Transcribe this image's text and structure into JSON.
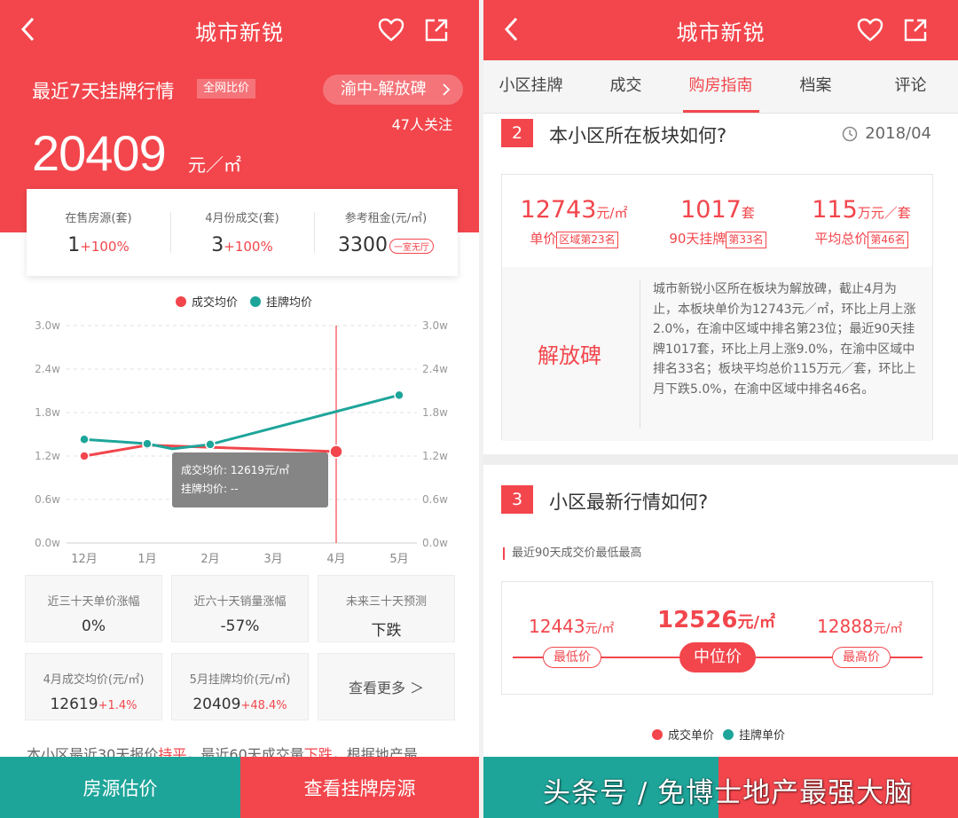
{
  "colors": {
    "brand_red": "#f2464c",
    "teal": "#1ea59a",
    "tooltip_gray": "#7a7a7a"
  },
  "left": {
    "nav": {
      "title": "城市新锐",
      "back_icon": "chevron-left-icon",
      "heart_icon": "heart-icon",
      "share_icon": "share-icon"
    },
    "headline": "最近7天挂牌行情",
    "compare_tag": "全网比价",
    "location_pill": "渝中-解放碑",
    "followers": "47人关注",
    "price": "20409",
    "price_unit": "元／㎡",
    "stats": [
      {
        "label": "在售房源(套)",
        "value": "1",
        "pct": "+100%"
      },
      {
        "label": "4月份成交(套)",
        "value": "3",
        "pct": "+100%"
      },
      {
        "label": "参考租金(元/㎡)",
        "value": "3300",
        "mini": "一室无厅"
      }
    ],
    "legend": [
      "成交均价",
      "挂牌均价"
    ],
    "tooltip": {
      "line1": "成交均价: 12619元/㎡",
      "line2": "挂牌均价: --"
    },
    "tiles": [
      {
        "label": "近三十天单价涨幅",
        "value": "0%"
      },
      {
        "label": "近六十天销量涨幅",
        "value": "-57%"
      },
      {
        "label": "未来三十天预测",
        "value": "下跌"
      },
      {
        "label": "4月成交均价(元/㎡)",
        "value": "12619",
        "pct": "+1.4%"
      },
      {
        "label": "5月挂牌均价(元/㎡)",
        "value": "20409",
        "pct": "+48.4%"
      },
      {
        "label": "查看更多 ＞"
      }
    ],
    "summary": {
      "a": "本小区最近30天报价",
      "b": "持平",
      "c": "，最近60天成交量",
      "d": "下跌",
      "e": "，根据地产最"
    },
    "buttons": {
      "estimate": "房源估价",
      "listings": "查看挂牌房源"
    }
  },
  "chart_data": {
    "type": "line",
    "categories": [
      "12月",
      "1月",
      "2月",
      "3月",
      "4月",
      "5月"
    ],
    "y_ticks": [
      "0.0w",
      "0.6w",
      "1.2w",
      "1.8w",
      "2.4w",
      "3.0w"
    ],
    "ylim": [
      0,
      3.0
    ],
    "series": [
      {
        "name": "成交均价",
        "color": "#f2464c",
        "points": [
          [
            0,
            1.2
          ],
          [
            1,
            1.35
          ],
          [
            4,
            1.2619
          ]
        ]
      },
      {
        "name": "挂牌均价",
        "color": "#1ea59a",
        "points": [
          [
            0,
            1.43
          ],
          [
            1,
            1.37
          ],
          [
            1.4,
            1.3
          ],
          [
            2,
            1.36
          ],
          [
            5,
            2.0409
          ]
        ]
      }
    ],
    "marker_index": 4
  },
  "right": {
    "nav": {
      "title": "城市新锐"
    },
    "tabs": [
      "小区挂牌",
      "成交",
      "购房指南",
      "档案",
      "评论"
    ],
    "active_tab": 2,
    "section2": {
      "num": "2",
      "title": "本小区所在板块如何?",
      "date": "2018/04",
      "kpis": [
        {
          "value": "12743",
          "unit": "元/㎡",
          "label": "单价",
          "rank": "区域第23名"
        },
        {
          "value": "1017",
          "unit": "套",
          "label": "90天挂牌",
          "rank": "第33名"
        },
        {
          "value": "115",
          "unit": "万元／套",
          "label": "平均总价",
          "rank": "第46名"
        }
      ],
      "area_name": "解放碑",
      "desc": "城市新锐小区所在板块为解放碑，截止4月为止，本板块单价为12743元／㎡，环比上月上涨2.0%，在渝中区域中排名第23位；最近90天挂牌1017套，环比上月上涨9.0%，在渝中区域中排名33名；板块平均总价115万元／套，环比上月下跌5.0%，在渝中区域中排名46名。"
    },
    "section3": {
      "num": "3",
      "title": "小区最新行情如何?",
      "note": "最近90天成交价最低最高",
      "low": {
        "value": "12443",
        "unit": "元/㎡",
        "label": "最低价"
      },
      "mid": {
        "value": "12526",
        "unit": "元/㎡",
        "label": "中位价"
      },
      "high": {
        "value": "12888",
        "unit": "元/㎡",
        "label": "最高价"
      },
      "legend": [
        "成交单价",
        "挂牌单价"
      ]
    },
    "watermark": "头条号 / 免博士地产最强大脑"
  }
}
